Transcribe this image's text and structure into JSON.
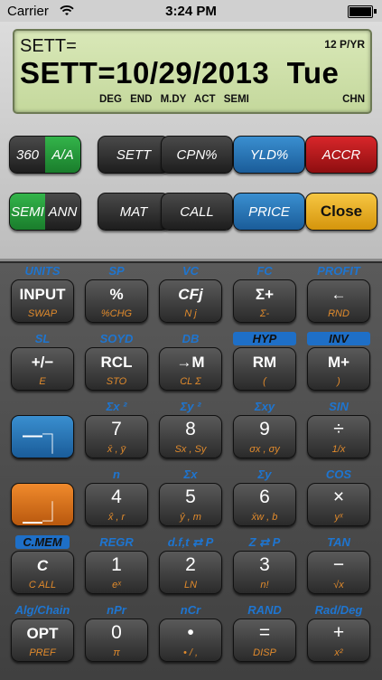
{
  "status": {
    "carrier": "Carrier",
    "time": "3:24 PM"
  },
  "display": {
    "line1": "SETT=",
    "payments_per_year": "12 P/YR",
    "line2": "SETT=10/29/2013  Tue",
    "indicators": "DEG END M.DY ACT SEMI",
    "chn": "CHN"
  },
  "function_keys": {
    "k360": "360",
    "kaa": "A/A",
    "sett": "SETT",
    "cpn": "CPN%",
    "yld": "YLD%",
    "accr": "ACCR",
    "semi": "SEMI",
    "ann": "ANN",
    "mat": "MAT",
    "call": "CALL",
    "price": "PRICE",
    "close": "Close"
  },
  "rows": [
    {
      "labels": [
        "UNITS",
        "SP",
        "VC",
        "FC",
        "PROFIT"
      ],
      "keys": [
        {
          "main": "INPUT",
          "sub": "SWAP"
        },
        {
          "main": "%",
          "sub": "%CHG"
        },
        {
          "main": "CFj",
          "sub": "N j"
        },
        {
          "main": "Σ+",
          "sub": "Σ-"
        },
        {
          "main": "←",
          "sub": "RND"
        }
      ]
    },
    {
      "labels": [
        "SL",
        "SOYD",
        "DB",
        "HYP",
        "INV"
      ],
      "keys": [
        {
          "main": "+/−",
          "sub": "E"
        },
        {
          "main": "RCL",
          "sub": "STO"
        },
        {
          "main": "→M",
          "sub": "CL Σ"
        },
        {
          "main": "RM",
          "sub": "("
        },
        {
          "main": "M+",
          "sub": ")"
        }
      ]
    },
    {
      "labels": [
        "",
        "Σx ²",
        "Σy ²",
        "Σxy",
        "SIN"
      ],
      "keys": [
        {
          "main": "",
          "sub": ""
        },
        {
          "main": "7",
          "sub": "x̄ , ȳ"
        },
        {
          "main": "8",
          "sub": "Sx , Sy"
        },
        {
          "main": "9",
          "sub": "σx , σy"
        },
        {
          "main": "÷",
          "sub": "1/x"
        }
      ]
    },
    {
      "labels": [
        "",
        "n",
        "Σx",
        "Σy",
        "COS"
      ],
      "keys": [
        {
          "main": "",
          "sub": ""
        },
        {
          "main": "4",
          "sub": "x̂ , r"
        },
        {
          "main": "5",
          "sub": "ŷ , m"
        },
        {
          "main": "6",
          "sub": "x̄w , b"
        },
        {
          "main": "×",
          "sub": "yˣ"
        }
      ]
    },
    {
      "labels": [
        "C.MEM",
        "REGR",
        "d.f,t ⇄ P",
        "Z ⇄ P",
        "TAN"
      ],
      "keys": [
        {
          "main": "C",
          "sub": "C ALL"
        },
        {
          "main": "1",
          "sub": "eˣ"
        },
        {
          "main": "2",
          "sub": "LN"
        },
        {
          "main": "3",
          "sub": "n!"
        },
        {
          "main": "−",
          "sub": "√x"
        }
      ]
    },
    {
      "labels": [
        "Alg/Chain",
        "nPr",
        "nCr",
        "RAND",
        "Rad/Deg"
      ],
      "keys": [
        {
          "main": "OPT",
          "sub": "PREF"
        },
        {
          "main": "0",
          "sub": "π"
        },
        {
          "main": "•",
          "sub": "• / ,"
        },
        {
          "main": "=",
          "sub": "DISP"
        },
        {
          "main": "+",
          "sub": "x²"
        }
      ]
    }
  ]
}
